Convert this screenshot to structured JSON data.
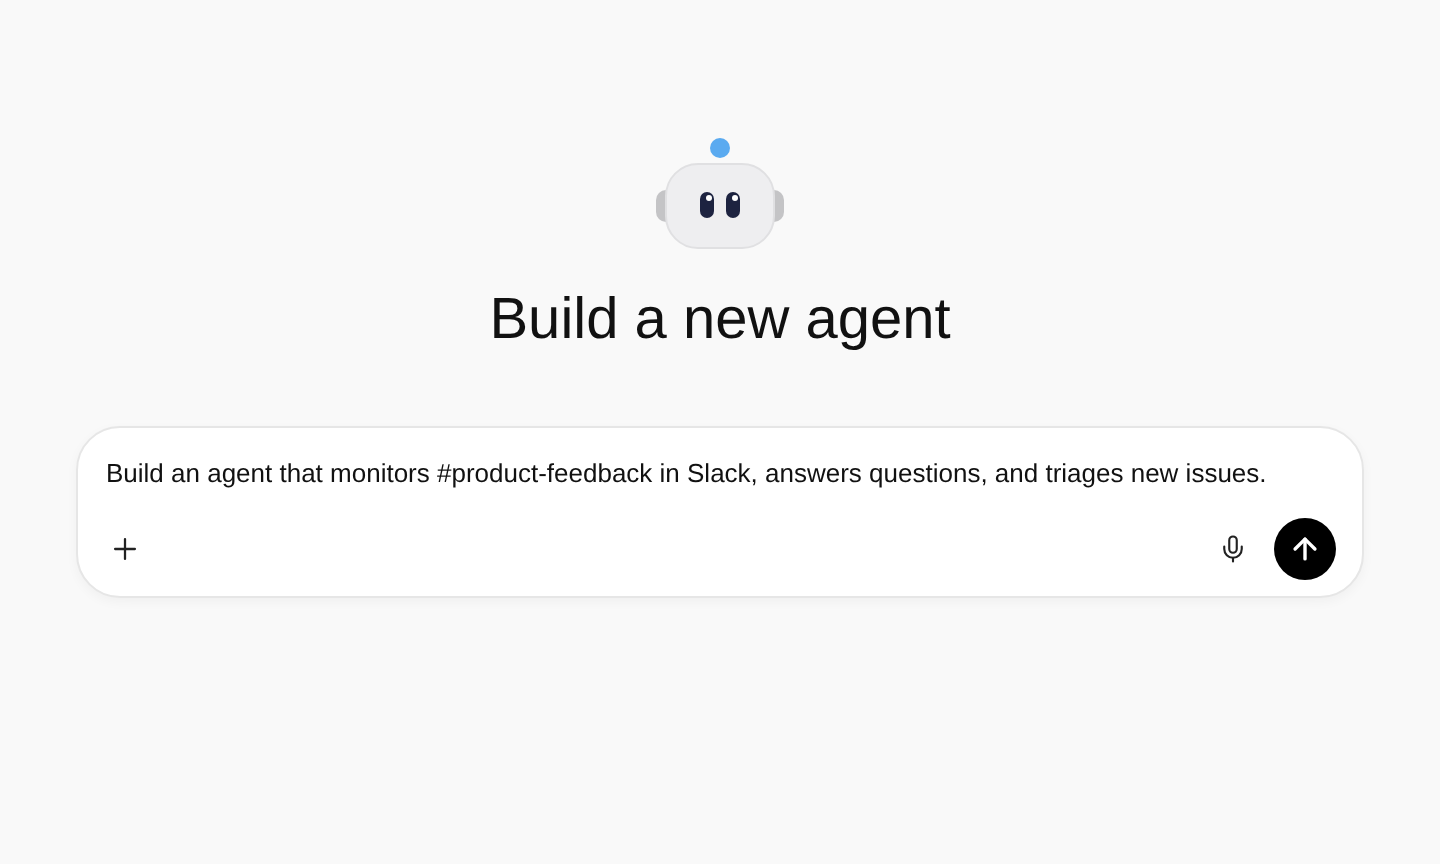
{
  "heading": "Build a new agent",
  "composer": {
    "value": "Build an agent that monitors #product-feedback in Slack, answers questions, and triages new issues."
  }
}
